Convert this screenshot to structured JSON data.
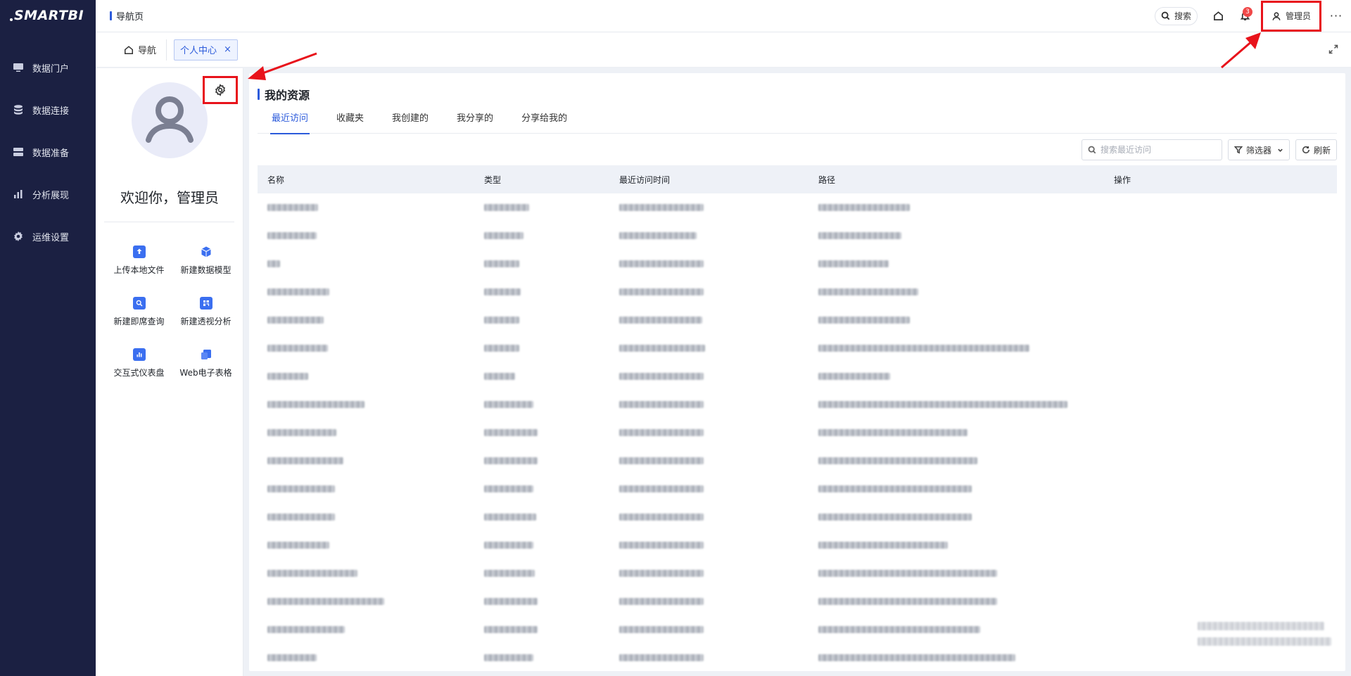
{
  "app": {
    "logo": "SMARTBI"
  },
  "sidebar": {
    "items": [
      {
        "label": "数据门户",
        "icon": "monitor-icon"
      },
      {
        "label": "数据连接",
        "icon": "database-icon"
      },
      {
        "label": "数据准备",
        "icon": "server-icon"
      },
      {
        "label": "分析展现",
        "icon": "bar-chart-icon"
      },
      {
        "label": "运维设置",
        "icon": "gear-icon"
      }
    ]
  },
  "topbar": {
    "breadcrumb": "导航页",
    "search_label": "搜索",
    "notification_count": "3",
    "user_label": "管理员",
    "more_label": "···"
  },
  "tabs": {
    "home_label": "导航",
    "active_label": "个人中心",
    "close_glyph": "×"
  },
  "profile": {
    "welcome": "欢迎你，管理员",
    "quick_actions": [
      {
        "label": "上传本地文件",
        "icon": "upload-file-icon"
      },
      {
        "label": "新建数据模型",
        "icon": "cube-icon"
      },
      {
        "label": "新建即席查询",
        "icon": "query-icon"
      },
      {
        "label": "新建透视分析",
        "icon": "pivot-table-icon"
      },
      {
        "label": "交互式仪表盘",
        "icon": "dashboard-icon"
      },
      {
        "label": "Web电子表格",
        "icon": "spreadsheet-icon"
      }
    ]
  },
  "resources": {
    "title": "我的资源",
    "tabs": [
      "最近访问",
      "收藏夹",
      "我创建的",
      "我分享的",
      "分享给我的"
    ],
    "active_tab": 0,
    "search_placeholder": "搜索最近访问",
    "filter_label": "筛选器",
    "refresh_label": "刷新",
    "columns": [
      "名称",
      "类型",
      "最近访问时间",
      "路径",
      "操作"
    ],
    "row_count_visible": 17
  },
  "colors": {
    "sidebar_bg": "#1b2042",
    "accent": "#2c5bdb",
    "annotation": "#e8131b"
  }
}
